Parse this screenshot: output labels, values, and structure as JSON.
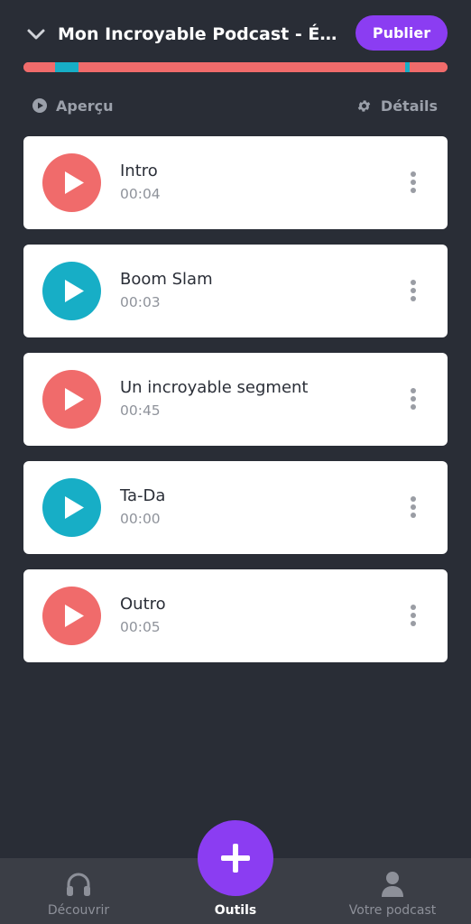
{
  "header": {
    "title": "Mon Incroyable Podcast - Épisode",
    "publish_label": "Publier",
    "collapse_icon": "chevron-down-icon"
  },
  "timeline": {
    "segments": [
      {
        "fraction": 0.075,
        "color": "#f06b6b"
      },
      {
        "fraction": 0.055,
        "color": "#17aec6"
      },
      {
        "fraction": 0.77,
        "color": "#f06b6b"
      },
      {
        "fraction": 0.01,
        "color": "#17aec6"
      },
      {
        "fraction": 0.09,
        "color": "#f06b6b"
      }
    ]
  },
  "subnav": {
    "preview_label": "Aperçu",
    "details_label": "Détails"
  },
  "segments": [
    {
      "name": "Intro",
      "duration": "00:04",
      "color": "#f06b6b"
    },
    {
      "name": "Boom Slam",
      "duration": "00:03",
      "color": "#17aec6"
    },
    {
      "name": "Un incroyable segment",
      "duration": "00:45",
      "color": "#f06b6b"
    },
    {
      "name": "Ta-Da",
      "duration": "00:00",
      "color": "#17aec6"
    },
    {
      "name": "Outro",
      "duration": "00:05",
      "color": "#f06b6b"
    }
  ],
  "tabs": {
    "discover": "Découvrir",
    "tools": "Outils",
    "your_podcast": "Votre podcast"
  },
  "colors": {
    "accent": "#8b3df2",
    "background": "#292d36",
    "coral": "#f06b6b",
    "teal": "#17aec6"
  }
}
